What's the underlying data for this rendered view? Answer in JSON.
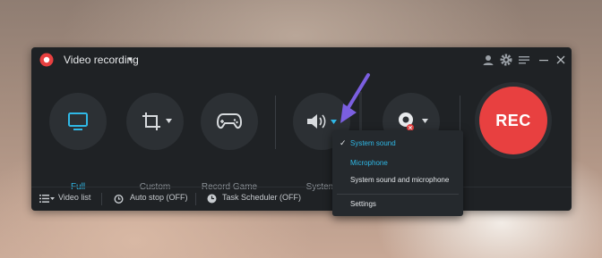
{
  "window": {
    "title": "Video recording",
    "title_caret": "▾",
    "toolbar_icons": [
      "account-icon",
      "settings-icon",
      "menu-icon",
      "minimize-icon",
      "close-icon"
    ]
  },
  "tools": [
    {
      "name": "full",
      "label": "Full",
      "icon": "monitor-icon",
      "active": true
    },
    {
      "name": "custom",
      "label": "Custom",
      "icon": "crop-icon",
      "active": false
    },
    {
      "name": "record-game",
      "label": "Record Game",
      "icon": "gamepad-icon",
      "active": false
    },
    {
      "name": "system-sound",
      "label": "System so",
      "icon": "speaker-icon",
      "active": false
    },
    {
      "name": "webcam",
      "label": "",
      "icon": "webcam-icon",
      "active": false
    }
  ],
  "rec_button": {
    "label": "REC",
    "color": "#e84040"
  },
  "bottombar": {
    "video_list": "Video list",
    "auto_stop": "Auto stop (OFF)",
    "task_scheduler": "Task Scheduler (OFF)"
  },
  "dropdown": {
    "check": "✓",
    "items": [
      "System sound",
      "Microphone",
      "System sound and microphone",
      "Settings"
    ],
    "selected": "System sound",
    "hovered": "Microphone"
  },
  "colors": {
    "accent": "#2fb8e6",
    "rec": "#e84040",
    "window_bg": "#1f2225",
    "pointer_arrow": "#7b5fe0"
  }
}
